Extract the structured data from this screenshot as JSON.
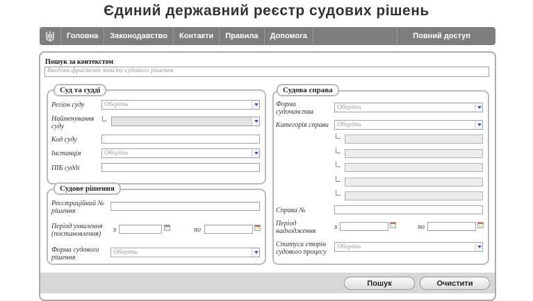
{
  "header": {
    "title": "Єдиний державний реєстр судових рішень"
  },
  "nav": {
    "items": [
      "Головна",
      "Законодавство",
      "Контакти",
      "Правила",
      "Допомога"
    ],
    "full_access": "Повний доступ"
  },
  "search": {
    "label": "Пошук за контекстом",
    "placeholder": "Введіть фрагмент тексту судового рішення"
  },
  "court": {
    "legend": "Суд та судді",
    "region_label": "Регіон суду",
    "region_value": "Оберіть",
    "name_label": "Найменування суду",
    "code_label": "Код суду",
    "instance_label": "Інстанція",
    "instance_value": "Оберіть",
    "judge_label": "ПІБ судді"
  },
  "decision": {
    "legend": "Судове рішення",
    "reg_label": "Реєстраційний № рішення",
    "period_label": "Період ухвалення (постановлення)",
    "from": "з",
    "to": "по",
    "form_label": "Форма судового рішення",
    "form_value": "Оберіть"
  },
  "case": {
    "legend": "Судова справа",
    "form_label": "Форма судочинства",
    "form_value": "Оберіть",
    "category_label": "Категорія справи",
    "category_value": "Оберіть",
    "number_label": "Справа №",
    "period_label": "Період надходження",
    "from": "з",
    "to": "по",
    "status_label": "Статуси сторін судового процесу",
    "status_value": "Оберіть"
  },
  "buttons": {
    "search": "Пошук",
    "clear": "Очистити"
  }
}
